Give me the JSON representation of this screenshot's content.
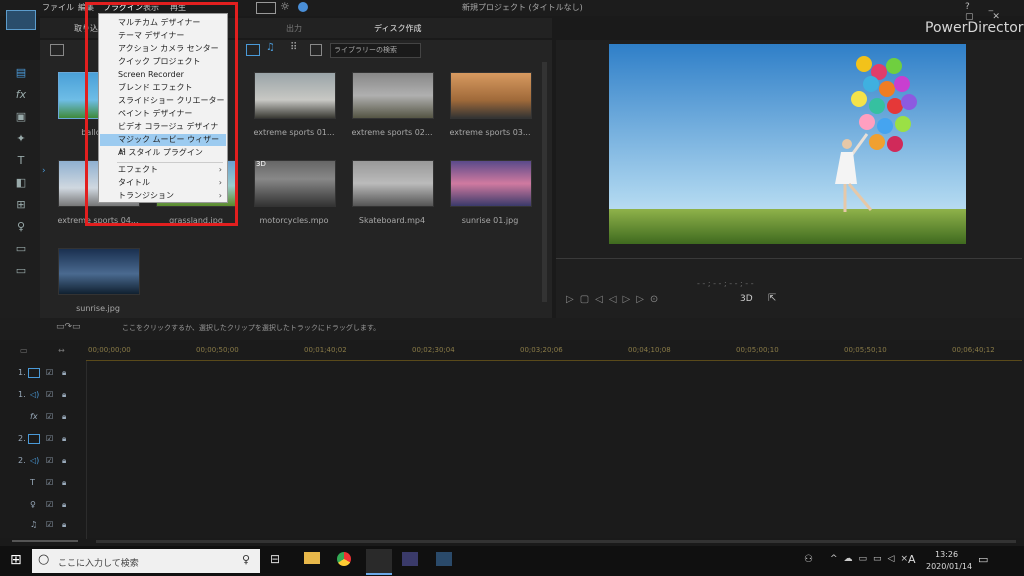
{
  "menubar": {
    "items": [
      "ファイル",
      "編集",
      "プラグイン",
      "表示",
      "再生"
    ],
    "title": "新規プロジェクト (タイトルなし)"
  },
  "tabs": [
    "取り込み",
    "出力",
    "ディスク作成"
  ],
  "brand": "PowerDirector",
  "window_controls": "? _ ▢ ✕",
  "library": {
    "search_placeholder": "ライブラリーの検索",
    "items": [
      {
        "label": "balloons"
      },
      {
        "label": ""
      },
      {
        "label": "extreme sports 01..."
      },
      {
        "label": "extreme sports 02..."
      },
      {
        "label": "extreme sports 03..."
      },
      {
        "label": "extreme sports 04..."
      },
      {
        "label": "grassland.jpg"
      },
      {
        "label": "motorcycles.mpo"
      },
      {
        "label": "Skateboard.mp4"
      },
      {
        "label": "sunrise 01.jpg"
      },
      {
        "label": "sunrise.jpg"
      }
    ],
    "thumb_3d_badge": "3D"
  },
  "preview": {
    "timecode": "- - ; - - ; - - ; - -",
    "mode_3d": "3D"
  },
  "hint": "ここをクリックするか、選択したクリップを選択したトラックにドラッグします。",
  "ruler": [
    "00;00;00;00",
    "00;00;50;00",
    "00;01;40;02",
    "00;02;30;04",
    "00;03;20;06",
    "00;04;10;08",
    "00;05;00;10",
    "00;05;50;10",
    "00;06;40;12"
  ],
  "tracks": [
    "1.",
    "1.",
    "",
    "2.",
    "2.",
    "",
    "",
    ""
  ],
  "dropdown": {
    "items": [
      "マルチカム デザイナー",
      "テーマ デザイナー",
      "アクション カメラ センター",
      "クイック プロジェクト",
      "Screen Recorder",
      "ブレンド エフェクト",
      "スライドショー クリエーター",
      "ペイント デザイナー",
      "ビデオ コラージュ デザイナー",
      "マジック ムービー ウィザード",
      "AI スタイル プラグイン"
    ],
    "highlighted_index": 9,
    "submenus": [
      "エフェクト",
      "タイトル",
      "トランジション"
    ]
  },
  "taskbar": {
    "search_placeholder": "ここに入力して検索",
    "time": "13:26",
    "date": "2020/01/14",
    "ime": "A"
  },
  "colors": {
    "highlight": "#9ccbf0",
    "redbox": "#e21f1f",
    "accent": "#5c9ccc"
  }
}
